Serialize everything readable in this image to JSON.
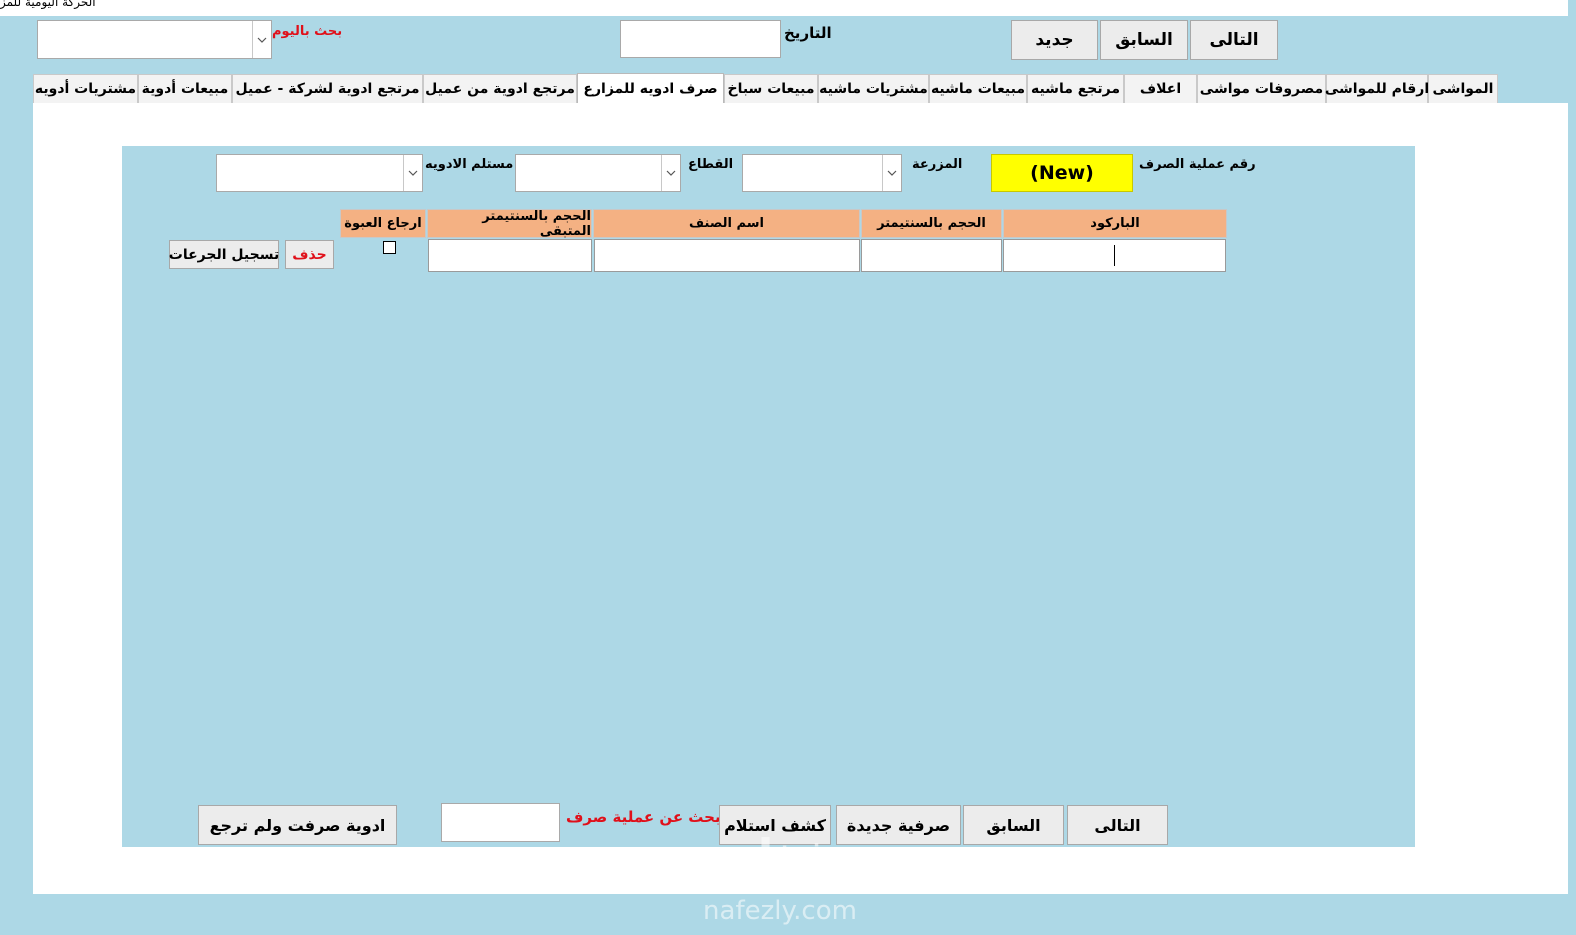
{
  "window": {
    "title": "الحركة اليومية للمز"
  },
  "top_bar": {
    "search_by_day_label": "بحث باليوم",
    "search_by_day_value": "",
    "date_label": "التاريخ",
    "date_value": "",
    "next_label": "التالى",
    "prev_label": "السابق",
    "new_label": "جديد"
  },
  "tabs": [
    {
      "label": "المواشى",
      "active": false
    },
    {
      "label": "ارقام للمواشى",
      "active": false
    },
    {
      "label": "مصروفات مواشى",
      "active": false
    },
    {
      "label": "اعلاف",
      "active": false
    },
    {
      "label": "مرتجع ماشيه",
      "active": false
    },
    {
      "label": "مبيعات ماشيه",
      "active": false
    },
    {
      "label": "مشتريات ماشيه",
      "active": false
    },
    {
      "label": "مبيعات سباخ",
      "active": false
    },
    {
      "label": "صرف ادويه للمزارع",
      "active": true
    },
    {
      "label": "مرتجع ادوية من عميل",
      "active": false
    },
    {
      "label": "مرتجع ادوية لشركة - عميل",
      "active": false
    },
    {
      "label": "مبيعات أدوية",
      "active": false
    },
    {
      "label": "مشتريات أدويه",
      "active": false
    }
  ],
  "form": {
    "op_number_label": "رقم عملية الصرف",
    "op_number_value": "(New)",
    "farm_label": "المزرعة",
    "sector_label": "القطاع",
    "receiver_label": "مستلم الادويه"
  },
  "grid": {
    "columns": {
      "barcode": "الباركود",
      "volume_cm": "الحجم بالسنتيمتر",
      "item_name": "اسم الصنف",
      "remaining_volume": "الحجم بالسنتيمتر المتبقى",
      "return_pack": "ارجاع العبوة"
    },
    "row": {
      "barcode": "",
      "volume_cm": "",
      "item_name": "",
      "remaining_volume": "",
      "return_pack": false
    },
    "delete_label": "حذف",
    "register_doses_label": "تسجيل الجرعات"
  },
  "bottom": {
    "next_label": "التالى",
    "prev_label": "السابق",
    "new_op_label": "صرفية جديدة",
    "receipt_statement_label": "كشف استلام",
    "search_op_label": "بحث عن عملية صرف",
    "search_op_value": "",
    "unreturned_label": "ادوية صرفت ولم ترجع"
  },
  "watermark": {
    "logo_text": "نفذلي",
    "site": "nafezly.com"
  }
}
